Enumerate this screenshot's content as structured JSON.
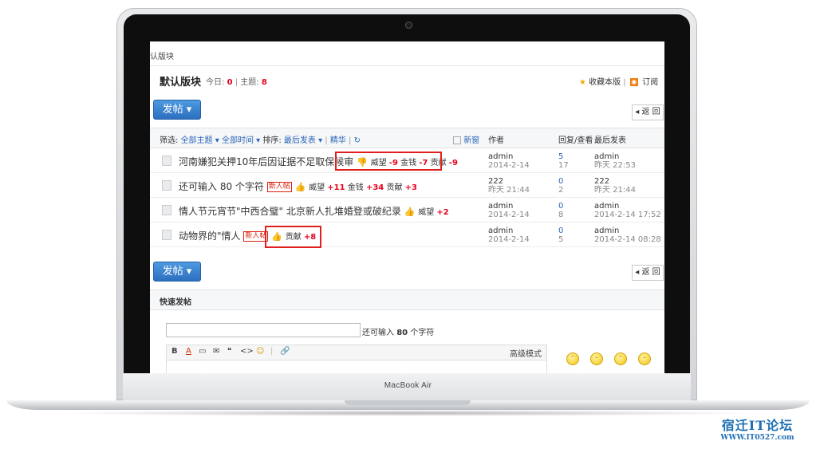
{
  "laptop": {
    "brand_label": "MacBook Air"
  },
  "forum": {
    "breadcrumb": "认版块",
    "title": "默认版块",
    "today_label": "今日:",
    "today_value": "0",
    "topics_label": "主题:",
    "topics_value": "8",
    "favorite_label": "收藏本版",
    "subscribe_label": "订阅",
    "post_button": "发帖 ▾",
    "back_button": "◂ 返 回",
    "filters": {
      "prefix": "筛选:",
      "all_topics": "全部主题 ▾",
      "all_time": "全部时间 ▾",
      "sort_label": "排序:",
      "sort_value": "最后发表 ▾",
      "digest": "精华",
      "refresh_icon": "↻",
      "new_window": "新窗",
      "col_author": "作者",
      "col_counts": "回复/查看",
      "col_last": "最后发表"
    },
    "threads": [
      {
        "title": "河南嫌犯关押10年后因证据不足取保候审",
        "new": "",
        "rating": [
          {
            "label": "威望",
            "value": "-9"
          },
          {
            "label": "金钱",
            "value": "-7"
          },
          {
            "label": "贡献",
            "value": "-9"
          }
        ],
        "author": "admin",
        "date": "2014-2-14",
        "replies": "5",
        "views": "17",
        "last_user": "admin",
        "last_time": "昨天 22:53"
      },
      {
        "title": "还可输入 80 个字符",
        "new": "新人帖",
        "rating": [
          {
            "label": "威望",
            "value": "+11"
          },
          {
            "label": "金钱",
            "value": "+34"
          },
          {
            "label": "贡献",
            "value": "+3"
          }
        ],
        "author": "222",
        "date": "昨天 21:44",
        "replies": "0",
        "views": "2",
        "last_user": "222",
        "last_time": "昨天 21:44"
      },
      {
        "title": "情人节元宵节\"中西合璧\" 北京新人扎堆婚登或破纪录",
        "new": "",
        "rating": [
          {
            "label": "威望",
            "value": "+2"
          }
        ],
        "author": "admin",
        "date": "2014-2-14",
        "replies": "0",
        "views": "8",
        "last_user": "admin",
        "last_time": "2014-2-14 17:52"
      },
      {
        "title": "动物界的\"情人",
        "new": "新人帖",
        "rating": [
          {
            "label": "贡献",
            "value": "+8"
          }
        ],
        "author": "admin",
        "date": "2014-2-14",
        "replies": "0",
        "views": "5",
        "last_user": "admin",
        "last_time": "2014-2-14 08:28"
      }
    ],
    "quick_post": {
      "title": "快速发帖",
      "char_hint_prefix": "还可输入",
      "char_hint_value": "80",
      "char_hint_suffix": "个字符",
      "advanced_mode": "高级模式",
      "toolbar": [
        "B",
        "A",
        "▭",
        "✉",
        "❝",
        "<>",
        "☺",
        "|",
        "🔗"
      ]
    }
  },
  "watermark": {
    "name": "宿迁IT论坛",
    "url": "WWW.IT0527.com"
  },
  "colors": {
    "accent_red": "#e8001c",
    "link_blue": "#2b65b7",
    "button_blue": "#2c6fbf",
    "highlight_box": "#e02020"
  }
}
